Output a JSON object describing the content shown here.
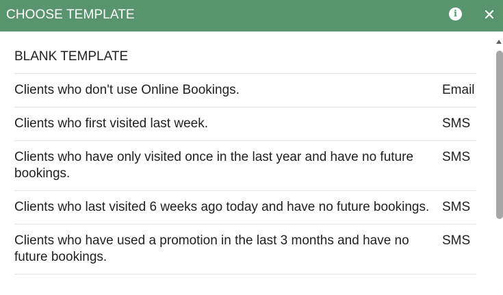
{
  "header": {
    "title": "CHOOSE TEMPLATE",
    "info_icon": "info-icon",
    "close_icon": "close-icon",
    "accent_color": "#58946e"
  },
  "templates": [
    {
      "description": "BLANK TEMPLATE",
      "type": ""
    },
    {
      "description": "Clients who don't use Online Bookings.",
      "type": "Email"
    },
    {
      "description": "Clients who first visited last week.",
      "type": "SMS"
    },
    {
      "description": "Clients who have only visited once in the last year and have no future bookings.",
      "type": "SMS"
    },
    {
      "description": "Clients who last visited 6 weeks ago today and have no future bookings.",
      "type": "SMS"
    },
    {
      "description": "Clients who have used a promotion in the last 3 months and have no future bookings.",
      "type": "SMS"
    }
  ]
}
